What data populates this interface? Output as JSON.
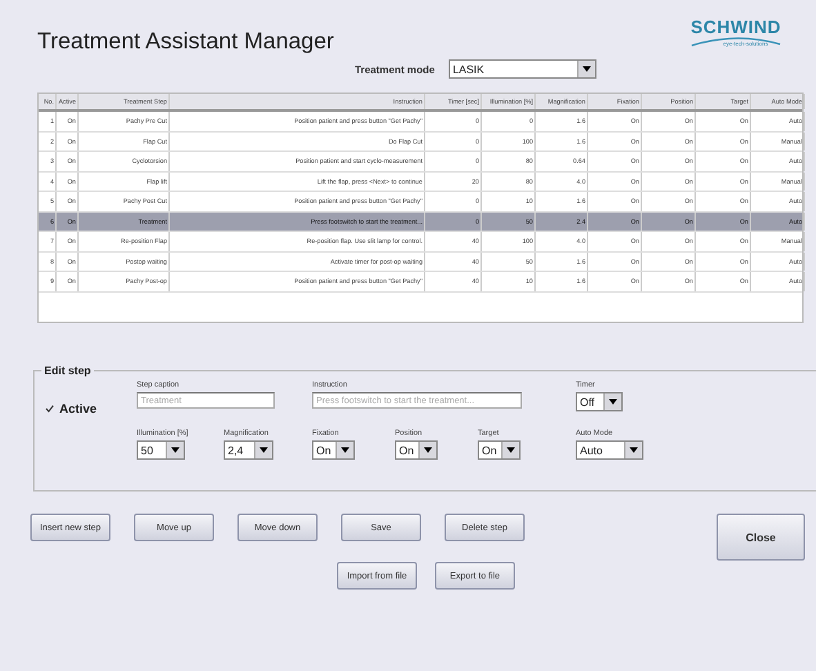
{
  "window": {
    "title": "Treatment Assistant Manager"
  },
  "logo": {
    "name": "SCHWIND",
    "tagline": "eye-tech-solutions"
  },
  "treatment_mode": {
    "label": "Treatment mode",
    "value": "LASIK"
  },
  "table": {
    "columns": [
      "No.",
      "Active",
      "Treatment Step",
      "Instruction",
      "Timer [sec]",
      "Illumination [%]",
      "Magnification",
      "Fixation",
      "Position",
      "Target",
      "Auto Mode"
    ],
    "rows": [
      {
        "selected": false,
        "cells": [
          "1",
          "On",
          "Pachy Pre Cut",
          "Position patient and press button \"Get Pachy\"",
          "0",
          "0",
          "1.6",
          "On",
          "On",
          "On",
          "Auto"
        ]
      },
      {
        "selected": false,
        "cells": [
          "2",
          "On",
          "Flap Cut",
          "Do Flap Cut",
          "0",
          "100",
          "1.6",
          "On",
          "On",
          "On",
          "Manual"
        ]
      },
      {
        "selected": false,
        "cells": [
          "3",
          "On",
          "Cyclotorsion",
          "Position patient and start cyclo-measurement",
          "0",
          "80",
          "0.64",
          "On",
          "On",
          "On",
          "Auto"
        ]
      },
      {
        "selected": false,
        "cells": [
          "4",
          "On",
          "Flap lift",
          "Lift the flap, press <Next> to continue",
          "20",
          "80",
          "4.0",
          "On",
          "On",
          "On",
          "Manual"
        ]
      },
      {
        "selected": false,
        "cells": [
          "5",
          "On",
          "Pachy Post Cut",
          "Position patient and press button \"Get Pachy\"",
          "0",
          "10",
          "1.6",
          "On",
          "On",
          "On",
          "Auto"
        ]
      },
      {
        "selected": true,
        "cells": [
          "6",
          "On",
          "Treatment",
          "Press footswitch to start the treatment...",
          "0",
          "50",
          "2.4",
          "On",
          "On",
          "On",
          "Auto"
        ]
      },
      {
        "selected": false,
        "cells": [
          "7",
          "On",
          "Re-position Flap",
          "Re-position flap. Use slit lamp for control.",
          "40",
          "100",
          "4.0",
          "On",
          "On",
          "On",
          "Manual"
        ]
      },
      {
        "selected": false,
        "cells": [
          "8",
          "On",
          "Postop waiting",
          "Activate timer for post-op waiting",
          "40",
          "50",
          "1.6",
          "On",
          "On",
          "On",
          "Auto"
        ]
      },
      {
        "selected": false,
        "cells": [
          "9",
          "On",
          "Pachy Post-op",
          "Position patient and press button \"Get Pachy\"",
          "40",
          "10",
          "1.6",
          "On",
          "On",
          "On",
          "Auto"
        ]
      }
    ]
  },
  "edit_step": {
    "title": "Edit step",
    "active": {
      "label": "Active",
      "checked": true
    },
    "step_caption": {
      "label": "Step caption",
      "value": "Treatment"
    },
    "instruction": {
      "label": "Instruction",
      "value": "Press footswitch to start the treatment..."
    },
    "timer": {
      "label": "Timer",
      "value": "Off"
    },
    "dropdowns": [
      {
        "label": "Illumination [%]",
        "value": "50"
      },
      {
        "label": "Magnification",
        "value": "2,4"
      },
      {
        "label": "Fixation",
        "value": "On"
      },
      {
        "label": "Position",
        "value": "On"
      },
      {
        "label": "Target",
        "value": "On"
      },
      {
        "label": "Auto Mode",
        "value": "Auto"
      }
    ]
  },
  "buttons": [
    "Insert new step",
    "Move up",
    "Move down",
    "Save",
    "Delete step"
  ],
  "file_buttons": [
    "Import from file",
    "Export to file"
  ],
  "close_button": "Close"
}
